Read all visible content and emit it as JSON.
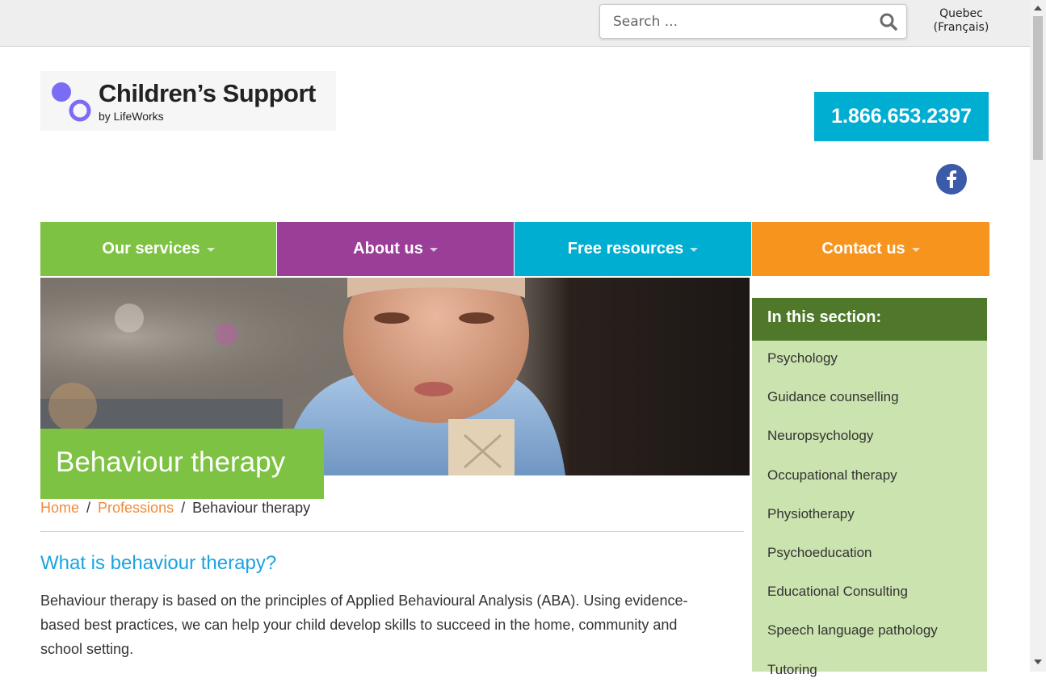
{
  "search": {
    "placeholder": "Search ..."
  },
  "language_link": {
    "line1": "Quebec",
    "line2": "(Français)"
  },
  "logo": {
    "title": "Children’s Support",
    "subtitle": "by LifeWorks"
  },
  "phone": "1.866.653.2397",
  "nav": {
    "items": [
      {
        "label": "Our services",
        "color": "#7dc242"
      },
      {
        "label": "About us",
        "color": "#9b3e97"
      },
      {
        "label": "Free resources",
        "color": "#00aed1"
      },
      {
        "label": "Contact us",
        "color": "#f7941d"
      }
    ]
  },
  "hero": {
    "title": "Behaviour therapy"
  },
  "breadcrumb": {
    "home": "Home",
    "professions": "Professions",
    "current": "Behaviour therapy",
    "separator": "/"
  },
  "main": {
    "heading": "What is behaviour therapy?",
    "paragraph_lines": [
      "Behaviour therapy is based on the principles of Applied Behavioural Analysis (ABA).  Using evidence-",
      "based best practices, we can help your child develop skills to succeed in the home, community and",
      "school setting."
    ]
  },
  "sidebar": {
    "heading": "In this section:",
    "items": [
      "Psychology",
      "Guidance counselling",
      "Neuropsychology",
      "Occupational therapy",
      "Physiotherapy",
      "Psychoeducation",
      "Educational Consulting",
      "Speech language pathology",
      "Tutoring"
    ]
  },
  "icons": {
    "search": "search-icon",
    "facebook": "facebook-icon"
  }
}
